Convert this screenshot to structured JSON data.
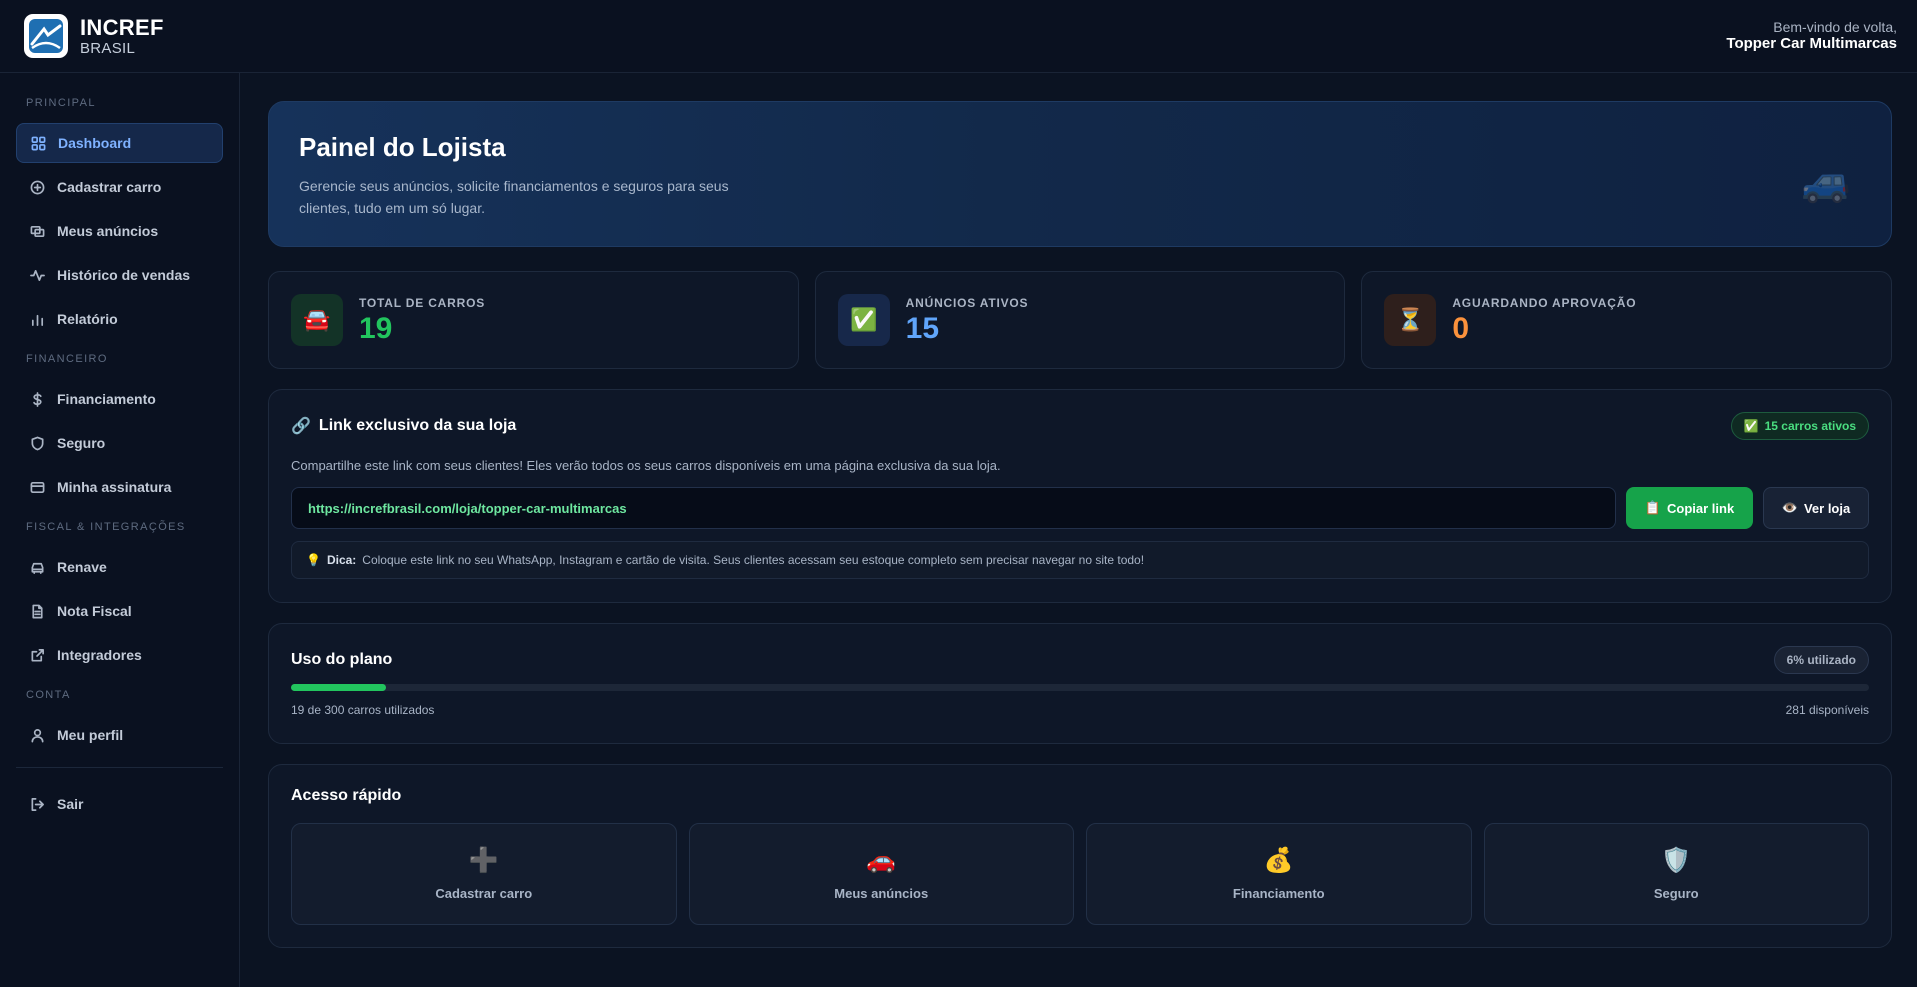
{
  "brand": {
    "name": "INCREF",
    "sub": "BRASIL"
  },
  "header": {
    "welcome": "Bem-vindo de volta,",
    "user": "Topper Car Multimarcas"
  },
  "sidebar": {
    "sections": {
      "principal": "PRINCIPAL",
      "financeiro": "FINANCEIRO",
      "fiscal": "FISCAL & INTEGRAÇÕES",
      "conta": "CONTA"
    },
    "items": {
      "dashboard": "Dashboard",
      "cadastrar": "Cadastrar carro",
      "anuncios": "Meus anúncios",
      "historico": "Histórico de vendas",
      "relatorio": "Relatório",
      "financiamento": "Financiamento",
      "seguro": "Seguro",
      "assinatura": "Minha assinatura",
      "renave": "Renave",
      "nota": "Nota Fiscal",
      "integradores": "Integradores",
      "perfil": "Meu perfil",
      "sair": "Sair"
    }
  },
  "hero": {
    "title": "Painel do Lojista",
    "desc": "Gerencie seus anúncios, solicite financiamentos e seguros para seus clientes, tudo em um só lugar.",
    "icon": "🚙"
  },
  "stats": [
    {
      "label": "TOTAL DE CARROS",
      "value": "19",
      "icon": "🚘",
      "color": "#22c55e"
    },
    {
      "label": "ANÚNCIOS ATIVOS",
      "value": "15",
      "icon": "✅",
      "color": "#60a5fa"
    },
    {
      "label": "AGUARDANDO APROVAÇÃO",
      "value": "0",
      "icon": "⏳",
      "color": "#fb923c"
    }
  ],
  "store_link": {
    "icon": "🔗",
    "title": "Link exclusivo da sua loja",
    "badge": "15 carros ativos",
    "badge_icon": "✅",
    "desc": "Compartilhe este link com seus clientes! Eles verão todos os seus carros disponíveis em uma página exclusiva da sua loja.",
    "url": "https://increfbrasil.com/loja/topper-car-multimarcas",
    "copy_label": "Copiar link",
    "copy_icon": "📋",
    "view_label": "Ver loja",
    "view_icon": "👁️",
    "tip_icon": "💡",
    "tip_label": "Dica:",
    "tip_text": "Coloque este link no seu WhatsApp, Instagram e cartão de visita. Seus clientes acessam seu estoque completo sem precisar navegar no site todo!"
  },
  "plan": {
    "title": "Uso do plano",
    "badge": "6% utilizado",
    "used_fraction": 0.06,
    "used_text": "19 de 300 carros utilizados",
    "available_text": "281 disponíveis"
  },
  "quick": {
    "title": "Acesso rápido",
    "items": [
      {
        "label": "Cadastrar carro",
        "icon": "➕"
      },
      {
        "label": "Meus anúncios",
        "icon": "🚗"
      },
      {
        "label": "Financiamento",
        "icon": "💰"
      },
      {
        "label": "Seguro",
        "icon": "🛡️"
      }
    ]
  }
}
